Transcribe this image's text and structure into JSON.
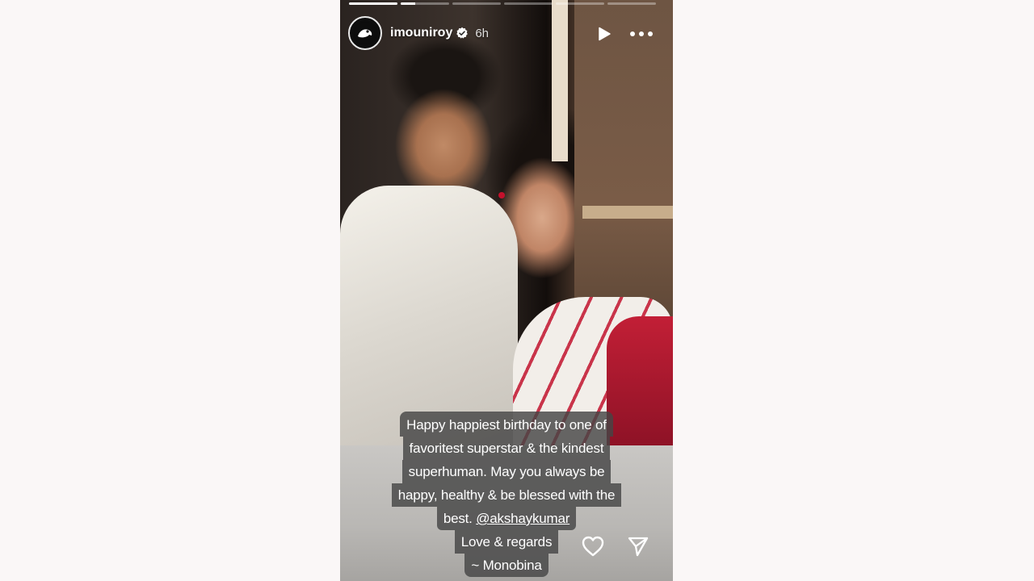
{
  "story": {
    "progress": [
      {
        "fill": 1.0
      },
      {
        "fill": 0.3
      },
      {
        "fill": 0.0
      },
      {
        "fill": 0.0
      },
      {
        "fill": 0.0
      },
      {
        "fill": 0.0
      }
    ],
    "user": {
      "username": "imouniroy",
      "verified": true,
      "time_ago": "6h",
      "avatar_icon": "avatar-logo-icon"
    },
    "controls": {
      "play_icon": "play-icon",
      "more_icon": "more-dots-icon"
    },
    "caption": {
      "lines": [
        "Happy happiest birthday to one of",
        "favoritest superstar & the kindest",
        "superhuman. May you always be",
        "happy, healthy & be blessed with the"
      ],
      "line5_prefix": "best. ",
      "mention": "@akshaykumar",
      "line6": "Love & regards",
      "line7": "~ Monobina"
    },
    "actions": {
      "like_icon": "heart-icon",
      "share_icon": "send-icon"
    },
    "colors": {
      "accent": "#ffffff",
      "verified_badge": "#ffffff",
      "caption_bg": "#464646"
    }
  }
}
